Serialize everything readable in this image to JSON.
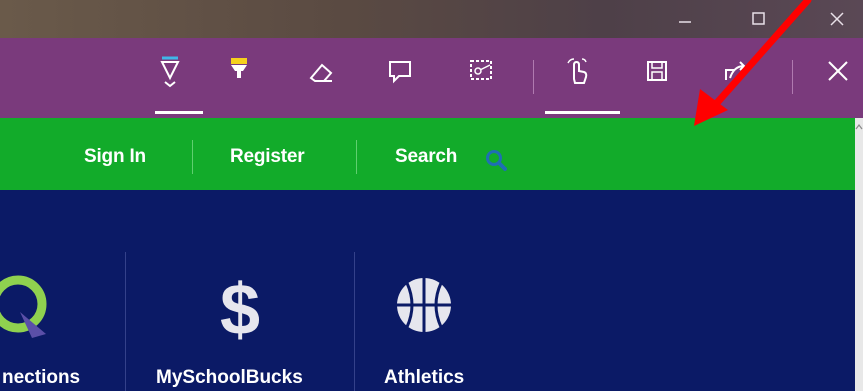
{
  "window": {
    "minimize_icon": "minimize-icon",
    "maximize_icon": "maximize-icon",
    "close_icon": "close-icon"
  },
  "toolbar": {
    "tools": [
      "ballpoint-pen-icon",
      "highlighter-icon",
      "eraser-icon",
      "add-note-icon",
      "clip-icon",
      "touch-writing-icon",
      "save-icon",
      "share-icon",
      "close-icon"
    ],
    "active_tool": "ballpoint-pen-icon",
    "pen_color": "#3fb6e8",
    "highlighter_color": "#f5d11c",
    "background": "#7a3a7c"
  },
  "nav": {
    "sign_in": "Sign In",
    "register": "Register",
    "search": "Search",
    "background": "#12ab2a"
  },
  "tiles": [
    {
      "label": "nections",
      "icon": "connections-icon"
    },
    {
      "label": "MySchoolBucks",
      "icon": "dollar-icon"
    },
    {
      "label": "Athletics",
      "icon": "basketball-icon"
    }
  ],
  "annotation": {
    "arrow_color": "#ff0000",
    "arrow_icon": "red-arrow-annotation"
  }
}
